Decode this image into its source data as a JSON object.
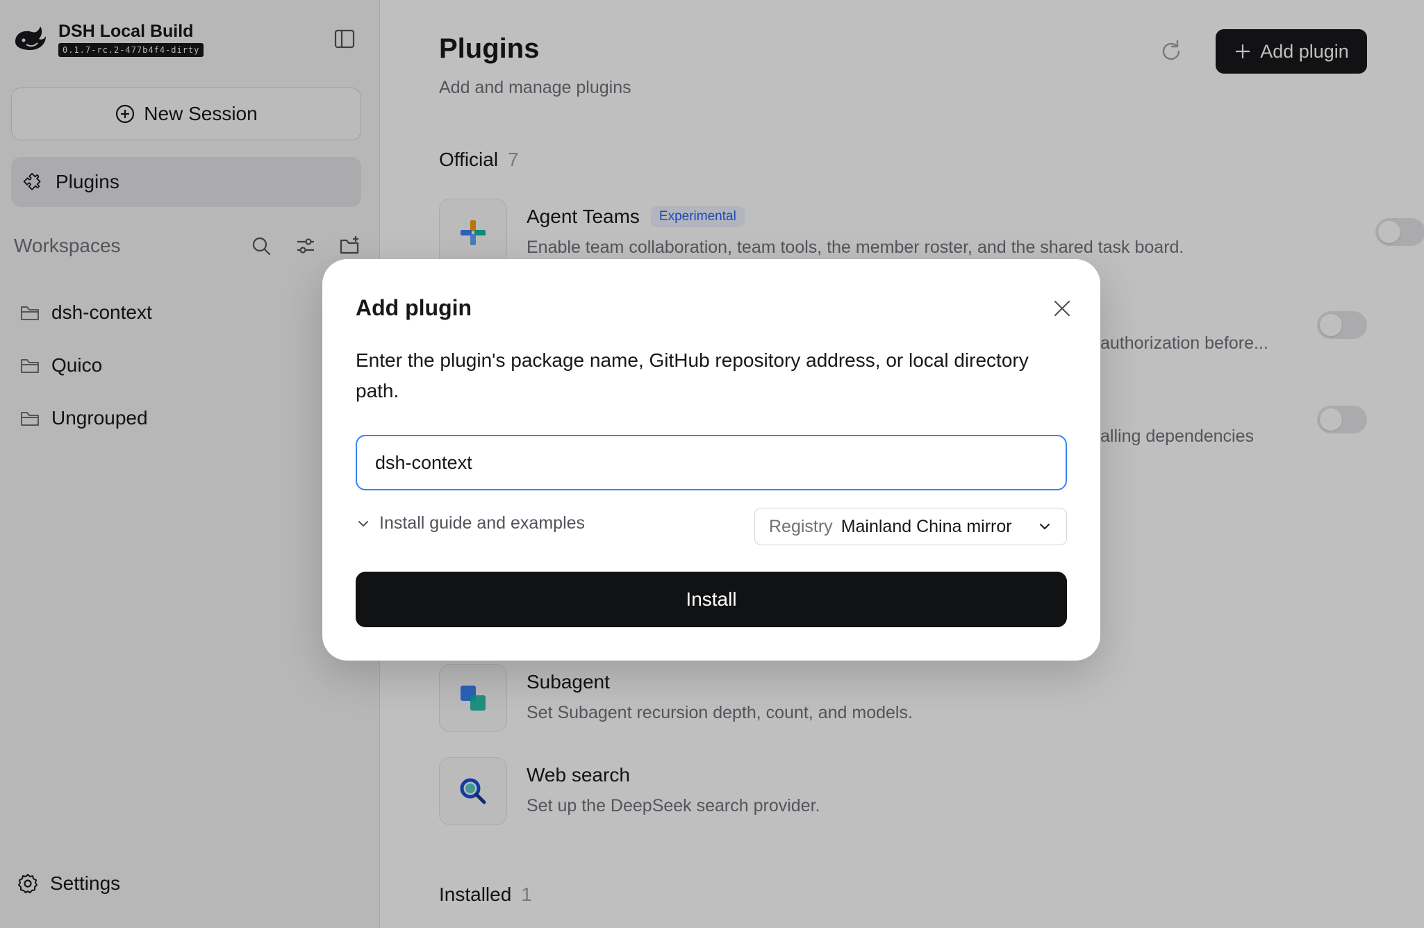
{
  "brand": {
    "title": "DSH Local Build",
    "version": "0.1.7-rc.2-477b4f4-dirty"
  },
  "sidebar": {
    "new_session_label": "New Session",
    "nav_plugins_label": "Plugins",
    "workspaces_label": "Workspaces",
    "workspaces": [
      {
        "label": "dsh-context"
      },
      {
        "label": "Quico"
      },
      {
        "label": "Ungrouped"
      }
    ],
    "settings_label": "Settings"
  },
  "main": {
    "title": "Plugins",
    "subtitle": "Add and manage plugins",
    "add_plugin_label": "Add plugin",
    "sections": {
      "official": {
        "label": "Official",
        "count": "7"
      },
      "installed": {
        "label": "Installed",
        "count": "1"
      }
    },
    "plugins": [
      {
        "name": "Agent Teams",
        "badge": "Experimental",
        "description": "Enable team collaboration, team tools, the member roster, and the shared task board.",
        "enabled": false
      },
      {
        "name": "Subagent",
        "description": "Set Subagent recursion depth, count, and models."
      },
      {
        "name": "Web search",
        "description": "Set up the DeepSeek search provider."
      }
    ],
    "partial_descriptions": [
      "authorization before...",
      "alling dependencies"
    ]
  },
  "modal": {
    "title": "Add plugin",
    "description": "Enter the plugin's package name, GitHub repository address, or local directory path.",
    "input_value": "dsh-context",
    "guide_label": "Install guide and examples",
    "registry_label": "Registry",
    "registry_value": "Mainland China mirror",
    "install_label": "Install"
  },
  "colors": {
    "accent": "#3b82f6",
    "primary_button": "#18181b",
    "badge_text": "#2563eb"
  }
}
